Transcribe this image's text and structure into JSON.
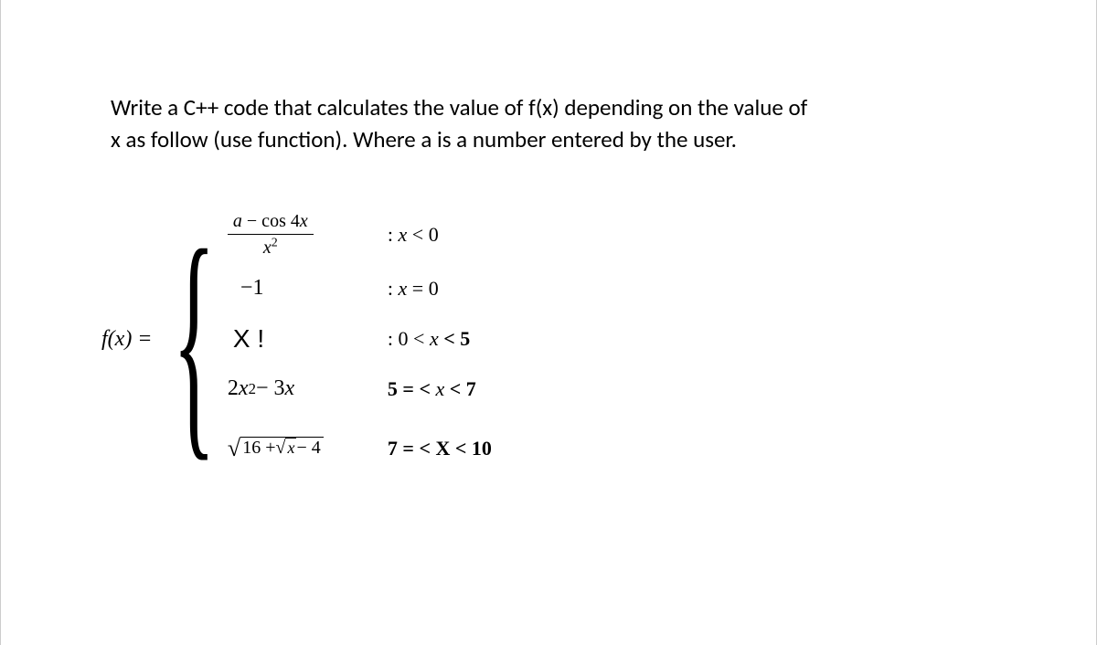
{
  "prompt": {
    "line1": "Write a C++ code that calculates the value of f(x) depending on the value of",
    "line2": "x as follow (use function).  Where a is a number entered by the user."
  },
  "function": {
    "label": "f(x) =",
    "cases": [
      {
        "expr_num_a": "a",
        "expr_num_minus": " − cos 4",
        "expr_num_x": "x",
        "expr_den_x": "x",
        "expr_den_sup": "2",
        "cond_prefix": ":  ",
        "cond_x": "x",
        "cond_rest": " < 0"
      },
      {
        "expr": "−1",
        "cond_prefix": ":  ",
        "cond_x": "x",
        "cond_rest": " = 0"
      },
      {
        "expr": "X !",
        "cond_prefix": ":  0 < ",
        "cond_x": "x",
        "cond_rest": " <  5"
      },
      {
        "expr_2": "2",
        "expr_x": "x",
        "expr_sup": "2",
        "expr_minus": " − 3",
        "expr_x2": "x",
        "cond_prefix": "5 = <  ",
        "cond_x": "x",
        "cond_rest": "  < 7"
      },
      {
        "root_16": "16 + ",
        "root_inner_x": "x",
        "root_tail": " − 4",
        "cond_prefix": "7 = <  ",
        "cond_x": "X",
        "cond_rest": "  <  10"
      }
    ]
  }
}
